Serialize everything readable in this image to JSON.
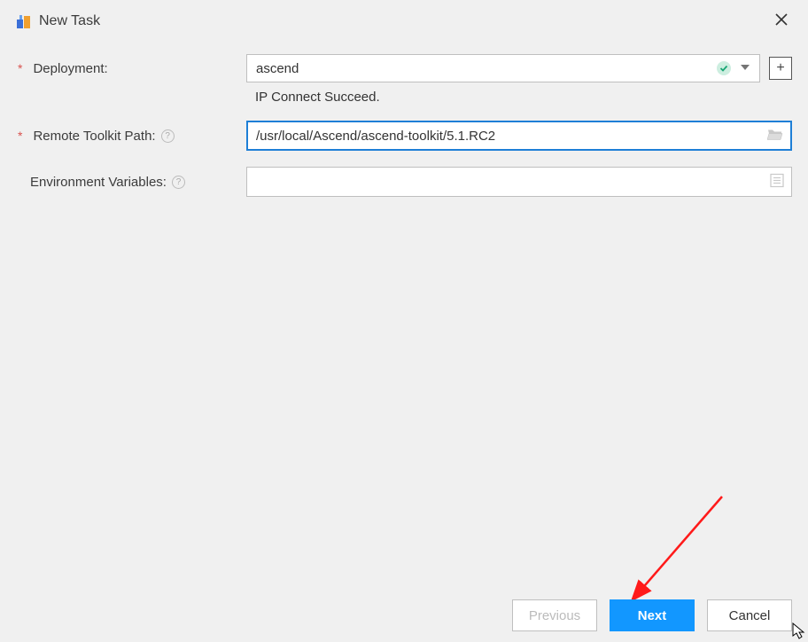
{
  "window": {
    "title": "New Task"
  },
  "form": {
    "deployment": {
      "label": "Deployment:",
      "value": "ascend",
      "status": "IP Connect Succeed."
    },
    "toolkit": {
      "label": "Remote Toolkit Path:",
      "value": "/usr/local/Ascend/ascend-toolkit/5.1.RC2"
    },
    "env": {
      "label": "Environment Variables:",
      "value": ""
    }
  },
  "buttons": {
    "previous": "Previous",
    "next": "Next",
    "cancel": "Cancel",
    "plus": "+"
  },
  "colors": {
    "accent": "#1297ff",
    "required": "#d9534f",
    "focus_border": "#1e7fd6"
  }
}
